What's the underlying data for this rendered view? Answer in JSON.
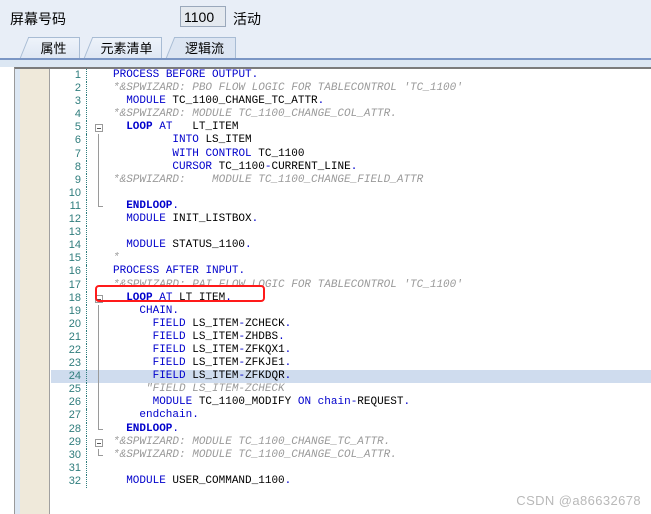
{
  "header": {
    "screen_number_label": "屏幕号码",
    "screen_number_value": "1100",
    "status_label": "活动"
  },
  "tabs": [
    {
      "id": "properties",
      "label": "属性",
      "active": false
    },
    {
      "id": "element-list",
      "label": "元素清单",
      "active": false
    },
    {
      "id": "flow-logic",
      "label": "逻辑流",
      "active": true
    }
  ],
  "editor": {
    "highlighted_line": 24,
    "annotated_line": 12,
    "annotation_color": "#ff1a1a",
    "lines": [
      {
        "n": 1,
        "text": "PROCESS BEFORE OUTPUT."
      },
      {
        "n": 2,
        "text": "*&SPWIZARD: PBO FLOW LOGIC FOR TABLECONTROL 'TC_1100'"
      },
      {
        "n": 3,
        "text": "  MODULE TC_1100_CHANGE_TC_ATTR."
      },
      {
        "n": 4,
        "text": "*&SPWIZARD: MODULE TC_1100_CHANGE_COL_ATTR."
      },
      {
        "n": 5,
        "text": "  LOOP AT   LT_ITEM"
      },
      {
        "n": 6,
        "text": "         INTO LS_ITEM"
      },
      {
        "n": 7,
        "text": "         WITH CONTROL TC_1100"
      },
      {
        "n": 8,
        "text": "         CURSOR TC_1100-CURRENT_LINE."
      },
      {
        "n": 9,
        "text": "*&SPWIZARD:    MODULE TC_1100_CHANGE_FIELD_ATTR"
      },
      {
        "n": 10,
        "text": ""
      },
      {
        "n": 11,
        "text": "  ENDLOOP."
      },
      {
        "n": 12,
        "text": "  MODULE INIT_LISTBOX."
      },
      {
        "n": 13,
        "text": ""
      },
      {
        "n": 14,
        "text": "  MODULE STATUS_1100."
      },
      {
        "n": 15,
        "text": "*"
      },
      {
        "n": 16,
        "text": "PROCESS AFTER INPUT."
      },
      {
        "n": 17,
        "text": "*&SPWIZARD: PAI FLOW LOGIC FOR TABLECONTROL 'TC_1100'"
      },
      {
        "n": 18,
        "text": "  LOOP AT LT_ITEM."
      },
      {
        "n": 19,
        "text": "    CHAIN."
      },
      {
        "n": 20,
        "text": "      FIELD LS_ITEM-ZCHECK."
      },
      {
        "n": 21,
        "text": "      FIELD LS_ITEM-ZHDBS."
      },
      {
        "n": 22,
        "text": "      FIELD LS_ITEM-ZFKQX1."
      },
      {
        "n": 23,
        "text": "      FIELD LS_ITEM-ZFKJE1."
      },
      {
        "n": 24,
        "text": "      FIELD LS_ITEM-ZFKDQR."
      },
      {
        "n": 25,
        "text": "     \"FIELD LS_ITEM-ZCHECK"
      },
      {
        "n": 26,
        "text": "      MODULE TC_1100_MODIFY ON chain-REQUEST."
      },
      {
        "n": 27,
        "text": "    endchain."
      },
      {
        "n": 28,
        "text": "  ENDLOOP."
      },
      {
        "n": 29,
        "text": "*&SPWIZARD: MODULE TC_1100_CHANGE_TC_ATTR."
      },
      {
        "n": 30,
        "text": "*&SPWIZARD: MODULE TC_1100_CHANGE_COL_ATTR."
      },
      {
        "n": 31,
        "text": ""
      },
      {
        "n": 32,
        "text": "  MODULE USER_COMMAND_1100."
      }
    ]
  },
  "watermark": {
    "text": "CSDN @a86632678"
  }
}
